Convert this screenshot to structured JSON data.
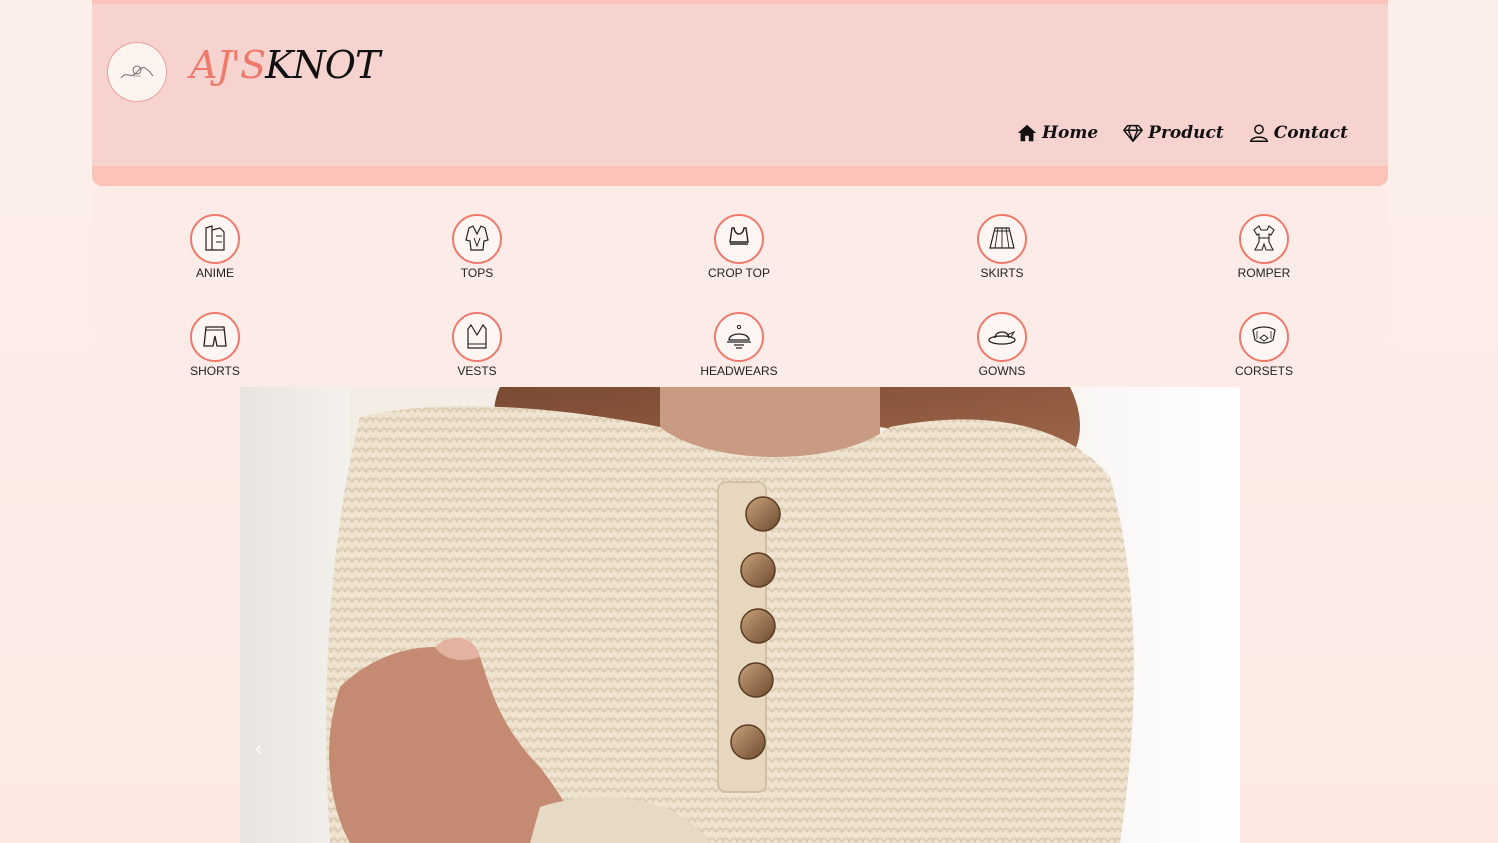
{
  "brand": {
    "part1": "AJ'S",
    "part2": "KNOT"
  },
  "nav": [
    {
      "label": "Home",
      "icon": "home-icon"
    },
    {
      "label": "Product",
      "icon": "diamond-icon"
    },
    {
      "label": "Contact",
      "icon": "user-icon"
    }
  ],
  "categories": [
    {
      "label": "ANIME",
      "icon": "anime-outfit-icon"
    },
    {
      "label": "TOPS",
      "icon": "tops-icon"
    },
    {
      "label": "CROP TOP",
      "icon": "crop-top-icon"
    },
    {
      "label": "SKIRTS",
      "icon": "skirt-icon"
    },
    {
      "label": "ROMPER",
      "icon": "romper-icon"
    },
    {
      "label": "SHORTS",
      "icon": "shorts-icon"
    },
    {
      "label": "VESTS",
      "icon": "vest-icon"
    },
    {
      "label": "HEADWEARS",
      "icon": "headwear-icon"
    },
    {
      "label": "GOWNS",
      "icon": "gown-hat-icon"
    },
    {
      "label": "CORSETS",
      "icon": "corset-icon"
    }
  ],
  "carousel": {
    "prev_symbol": "‹"
  },
  "colors": {
    "accent": "#ef7a6c",
    "header_bg": "#f6d3cf",
    "header_band": "#fcc4b8",
    "page_bg": "#fcefea"
  }
}
